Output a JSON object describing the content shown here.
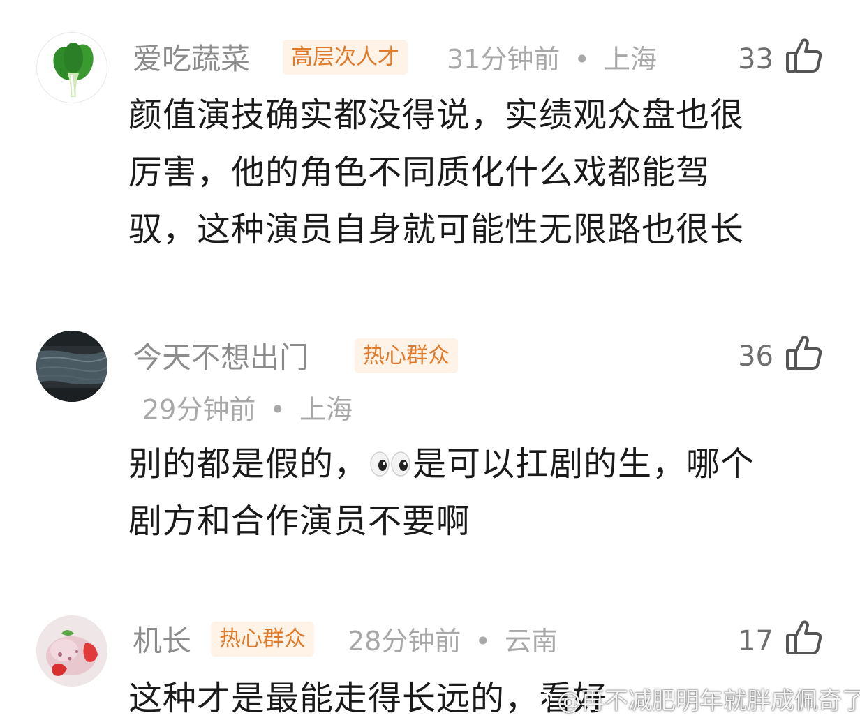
{
  "comments": [
    {
      "username": "爱吃蔬菜",
      "badge": "高层次人才",
      "time": "31分钟前",
      "dot": "•",
      "location": "上海",
      "likes": "33",
      "avatar_icon": "bok-choy-icon",
      "lines": [
        "颜值演技确实都没得说，实绩观众盘也很",
        "厉害，他的角色不同质化什么戏都能驾",
        "驭，这种演员自身就可能性无限路也很长"
      ]
    },
    {
      "username": "今天不想出门",
      "badge": "热心群众",
      "time": "29分钟前",
      "dot": "•",
      "location": "上海",
      "likes": "36",
      "avatar_icon": "dark-texture-avatar",
      "line1_before": "别的都是假的，",
      "emoji_icon": "eyes-emoji-icon",
      "line1_after": "是可以扛剧的生，哪个",
      "line2": "剧方和合作演员不要啊"
    },
    {
      "username": "机长",
      "badge": "热心群众",
      "time": "28分钟前",
      "dot": "•",
      "location": "云南",
      "likes": "17",
      "avatar_icon": "ice-cream-strawberry-avatar",
      "line1": "这种才是最能走得长远的，看好"
    }
  ],
  "like_icon": "thumbs-up-icon",
  "watermark": {
    "logo_icon": "weibo-logo-icon",
    "text": "@再不减肥明年就胖成佩奇了"
  },
  "colors": {
    "username": "#8c8c8c",
    "badge_text": "#e07a2a",
    "badge_bg": "#fff2e6",
    "meta": "#a8a8a8",
    "body_text": "#1a1a1a"
  }
}
